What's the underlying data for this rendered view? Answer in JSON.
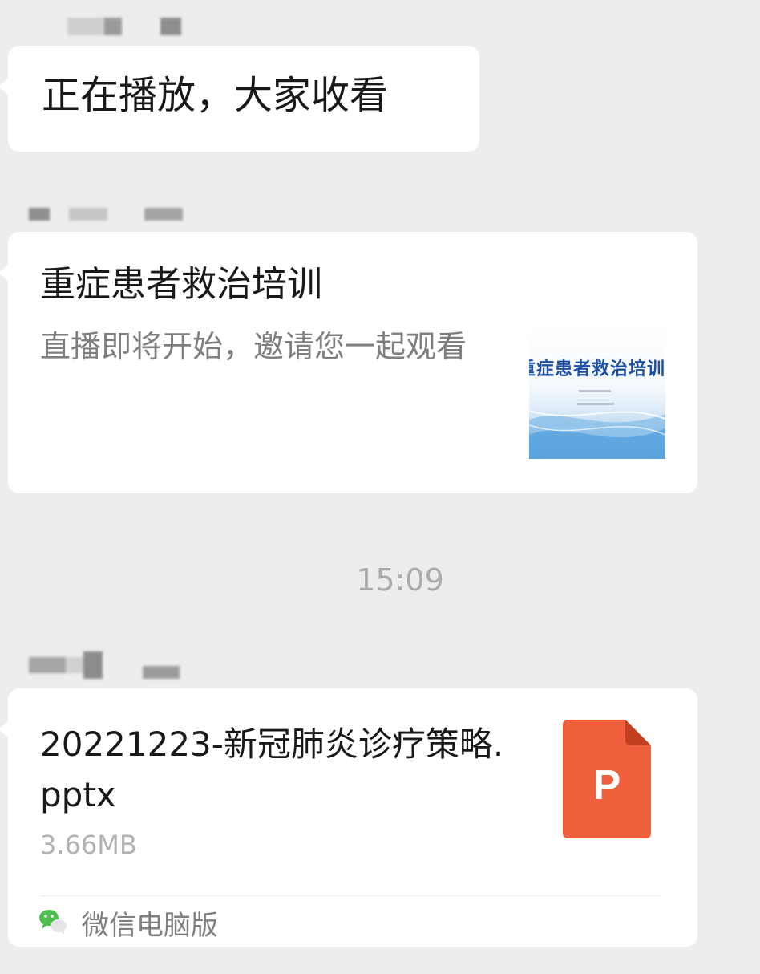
{
  "chat": {
    "messages": [
      {
        "type": "text",
        "sender": "",
        "text": "正在播放，大家收看"
      },
      {
        "type": "link_card",
        "sender": "",
        "title": "重症患者救治培训",
        "description": "直播即将开始，邀请您一起观看",
        "thumbnail": {
          "title": "重症患者救治培训"
        }
      },
      {
        "type": "timestamp",
        "text": "15:09"
      },
      {
        "type": "file_card",
        "sender": "",
        "file_name": "20221223-新冠肺炎诊疗策略.pptx",
        "file_size": "3.66MB",
        "file_icon": {
          "name": "powerpoint-file-icon",
          "letter": "P",
          "color": "#f0603c"
        },
        "source": {
          "icon": "wechat-icon",
          "label": "微信电脑版"
        }
      }
    ]
  },
  "colors": {
    "background": "#ededed",
    "bubble": "#ffffff",
    "secondary_text": "#7f7f7f",
    "timestamp": "#ababab",
    "wechat_green": "#4cbf4c"
  }
}
